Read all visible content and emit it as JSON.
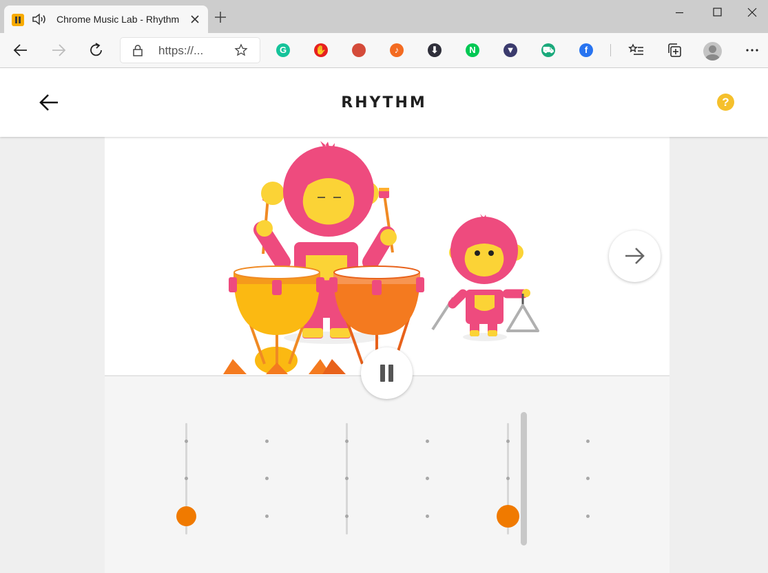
{
  "browser": {
    "tab_title": "Chrome Music Lab - Rhythm",
    "address": "https://...",
    "extensions": [
      {
        "name": "grammarly-extension-icon",
        "color": "#15c39a",
        "glyph": "G"
      },
      {
        "name": "adblock-extension-icon",
        "color": "#e62020",
        "glyph": "✋"
      },
      {
        "name": "book-extension-icon",
        "color": "#d44b3a",
        "glyph": ""
      },
      {
        "name": "music-extension-icon",
        "color": "#f36b21",
        "glyph": "♪"
      },
      {
        "name": "download-extension-icon",
        "color": "#2f2f3a",
        "glyph": "⬇"
      },
      {
        "name": "n-extension-icon",
        "color": "#00c853",
        "glyph": "N"
      },
      {
        "name": "fox-extension-icon",
        "color": "#3b3b6d",
        "glyph": "▼"
      },
      {
        "name": "cart-extension-icon",
        "color": "#1aa97b",
        "glyph": "⛟"
      },
      {
        "name": "flipkart-extension-icon",
        "color": "#2874f0",
        "glyph": "f"
      }
    ]
  },
  "app": {
    "title": "RHYTHM",
    "help_glyph": "?"
  },
  "sequencer": {
    "columns": 6,
    "rows": 3,
    "active_notes": [
      {
        "column": 1,
        "row": 3
      },
      {
        "column": 5,
        "row": 3
      }
    ],
    "playhead_column": 5,
    "state": "playing"
  },
  "colors": {
    "note": "#f07a00",
    "monkey_pink": "#ee4b7e",
    "monkey_yellow": "#fbd336",
    "drum_yellow": "#fbb912",
    "drum_orange": "#f47a1f",
    "help": "#f5c02c"
  }
}
